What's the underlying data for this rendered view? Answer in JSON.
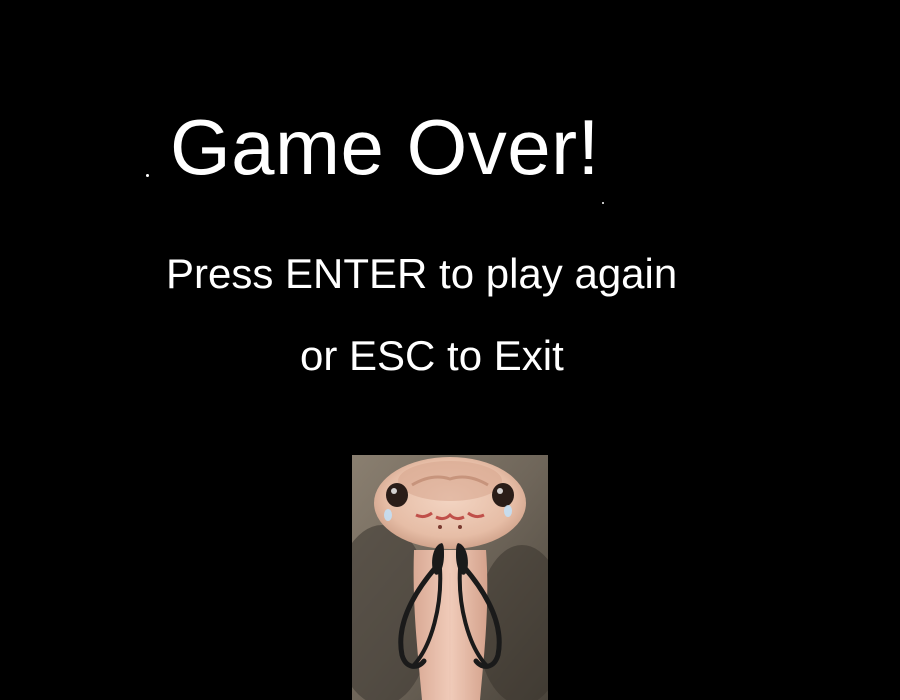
{
  "game_over": {
    "title": "Game Over!",
    "instruction_line1": "Press ENTER to play again",
    "instruction_line2": "or ESC to Exit"
  },
  "controls": {
    "play_again_key": "ENTER",
    "exit_key": "ESC"
  },
  "image": {
    "subject": "crying-snake"
  },
  "colors": {
    "background": "#000000",
    "text": "#ffffff"
  }
}
